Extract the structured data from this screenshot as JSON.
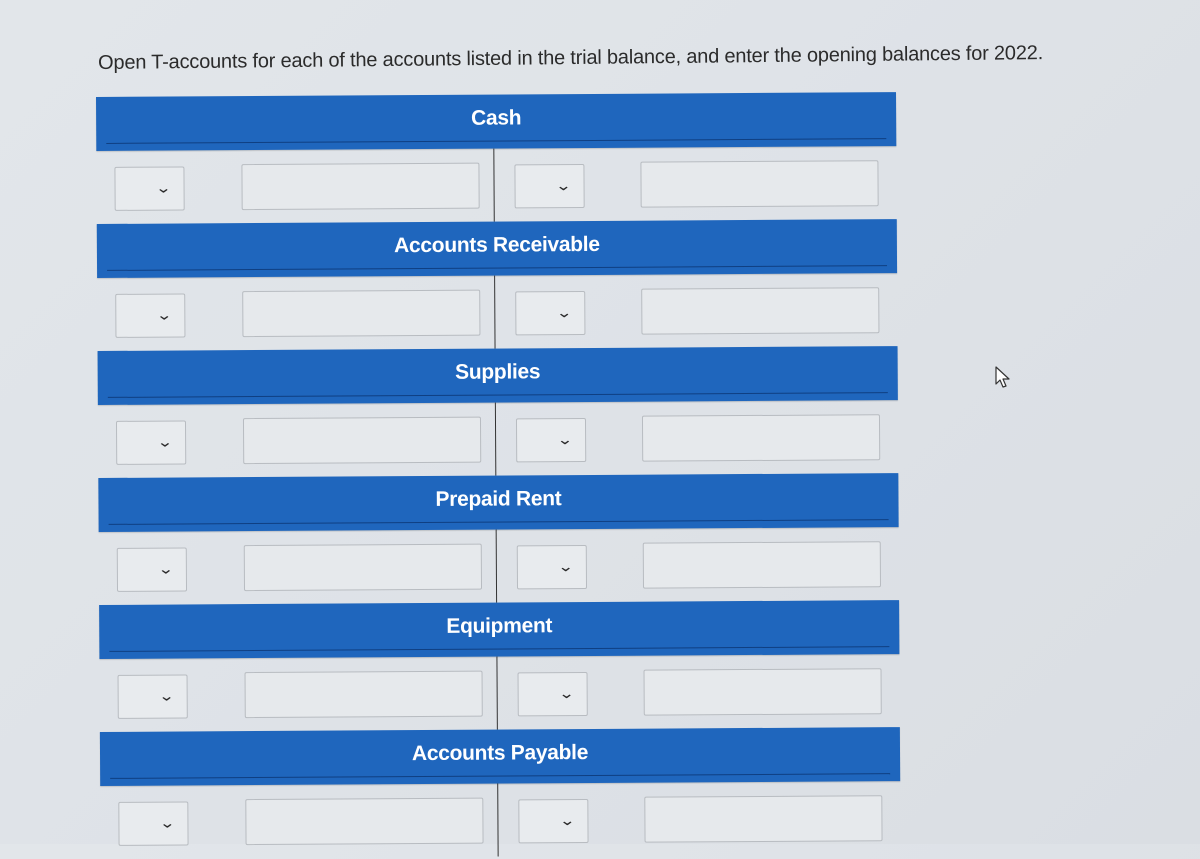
{
  "instruction": "Open T-accounts for each of the accounts listed in the trial balance, and enter the opening balances for 2022.",
  "colors": {
    "header_bg": "#1f66bd",
    "header_text": "#ffffff"
  },
  "icons": {
    "dropdown": "chevron-down-icon",
    "cursor": "mouse-pointer-icon"
  },
  "dropdown_glyph": "⌄",
  "t_accounts": [
    {
      "title": "Cash",
      "debit_side": {
        "selected": "",
        "amount": ""
      },
      "credit_side": {
        "selected": "",
        "amount": ""
      }
    },
    {
      "title": "Accounts Receivable",
      "debit_side": {
        "selected": "",
        "amount": ""
      },
      "credit_side": {
        "selected": "",
        "amount": ""
      }
    },
    {
      "title": "Supplies",
      "debit_side": {
        "selected": "",
        "amount": ""
      },
      "credit_side": {
        "selected": "",
        "amount": ""
      }
    },
    {
      "title": "Prepaid Rent",
      "debit_side": {
        "selected": "",
        "amount": ""
      },
      "credit_side": {
        "selected": "",
        "amount": ""
      }
    },
    {
      "title": "Equipment",
      "debit_side": {
        "selected": "",
        "amount": ""
      },
      "credit_side": {
        "selected": "",
        "amount": ""
      }
    },
    {
      "title": "Accounts Payable",
      "debit_side": {
        "selected": "",
        "amount": ""
      },
      "credit_side": {
        "selected": "",
        "amount": ""
      }
    }
  ]
}
